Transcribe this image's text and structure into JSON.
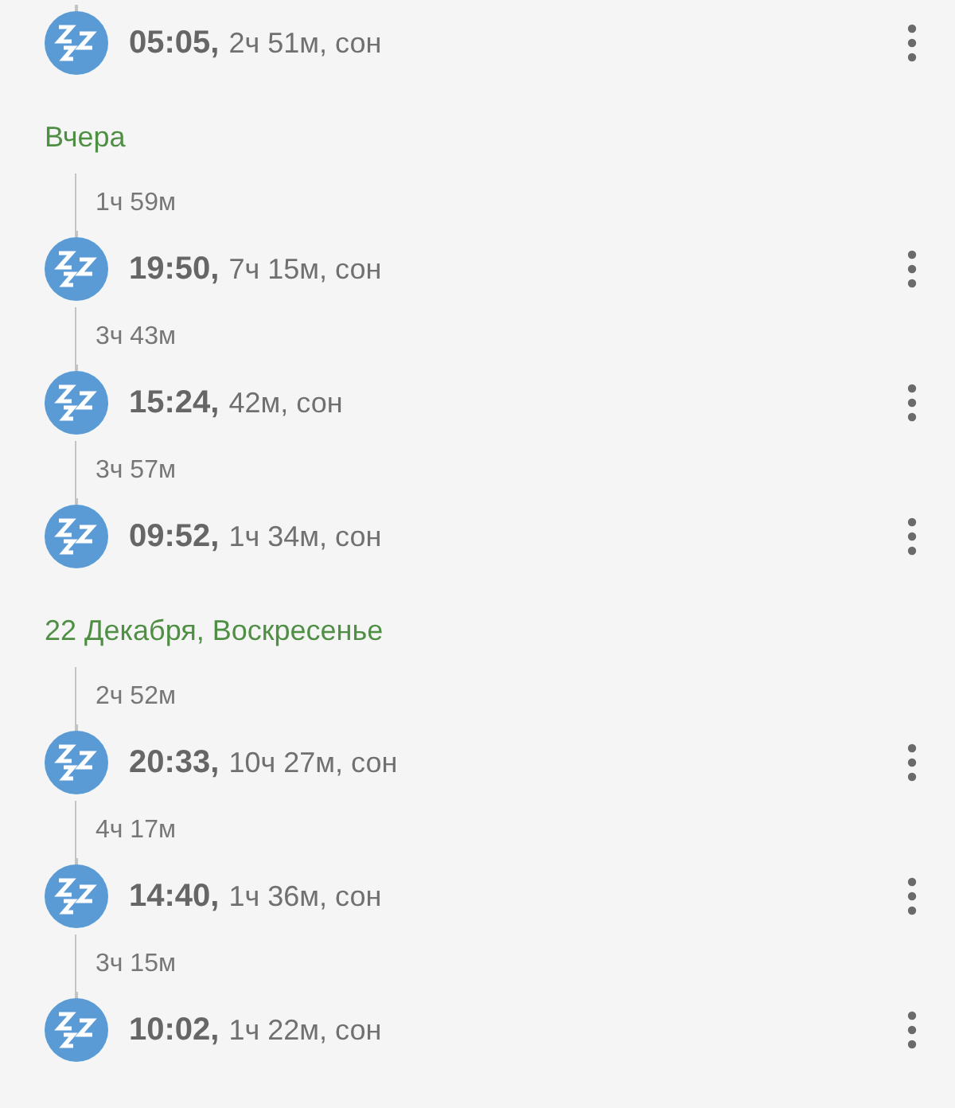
{
  "groups": [
    {
      "entries": [
        {
          "time": "05:05,",
          "detail": "2ч 51м, сон"
        }
      ]
    },
    {
      "header": "Вчера",
      "entries": [
        {
          "gap": "1ч 59м",
          "time": "19:50,",
          "detail": "7ч 15м, сон"
        },
        {
          "gap": "3ч 43м",
          "time": "15:24,",
          "detail": "42м, сон"
        },
        {
          "gap": "3ч 57м",
          "time": "09:52,",
          "detail": "1ч 34м, сон"
        }
      ]
    },
    {
      "header": "22 Декабря, Воскресенье",
      "entries": [
        {
          "gap": "2ч 52м",
          "time": "20:33,",
          "detail": "10ч 27м, сон"
        },
        {
          "gap": "4ч 17м",
          "time": "14:40,",
          "detail": "1ч 36м, сон"
        },
        {
          "gap": "3ч 15м",
          "time": "10:02,",
          "detail": "1ч 22м, сон"
        }
      ]
    }
  ]
}
